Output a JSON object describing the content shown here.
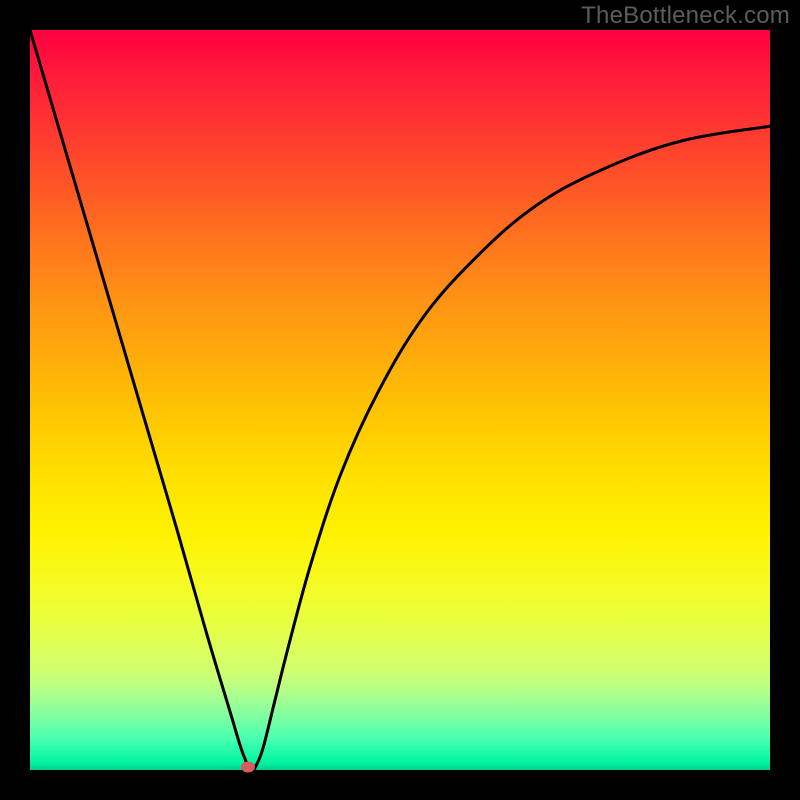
{
  "watermark": "TheBottleneck.com",
  "chart_data": {
    "type": "line",
    "title": "",
    "xlabel": "",
    "ylabel": "",
    "xlim": [
      0,
      1
    ],
    "ylim": [
      0,
      1
    ],
    "background": {
      "kind": "vertical-gradient",
      "top_color": "#ff0040",
      "mid_color": "#ffe200",
      "bottom_color": "#00d090",
      "meaning": "top=high bottleneck (red), bottom=low bottleneck (green)"
    },
    "series": [
      {
        "name": "bottleneck-curve",
        "x": [
          0.0,
          0.05,
          0.1,
          0.15,
          0.2,
          0.24,
          0.27,
          0.285,
          0.295,
          0.3,
          0.305,
          0.315,
          0.33,
          0.35,
          0.38,
          0.42,
          0.47,
          0.53,
          0.6,
          0.68,
          0.77,
          0.88,
          1.0
        ],
        "y": [
          1.0,
          0.83,
          0.66,
          0.49,
          0.32,
          0.18,
          0.08,
          0.03,
          0.005,
          0.0,
          0.005,
          0.03,
          0.09,
          0.17,
          0.28,
          0.4,
          0.51,
          0.61,
          0.69,
          0.76,
          0.81,
          0.85,
          0.87
        ],
        "color": "#000000"
      }
    ],
    "marker": {
      "name": "optimal-point",
      "x": 0.295,
      "y": 0.0,
      "color": "#d85a5a"
    },
    "notes": "Axes are unlabeled in the source image; x/y values are normalized to the [0,1] plot area (0 at left/bottom, 1 at right/top)."
  }
}
